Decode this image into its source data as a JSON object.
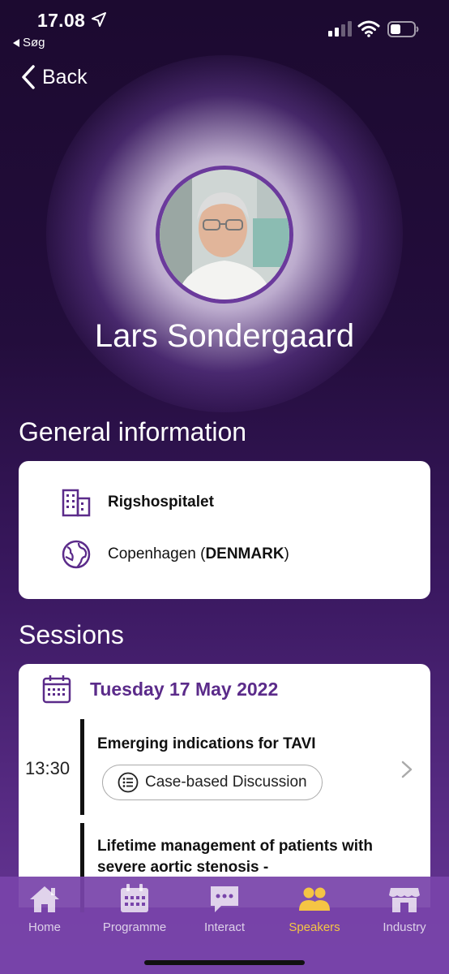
{
  "status_bar": {
    "time": "17.08",
    "back_app": "Søg"
  },
  "nav": {
    "back_label": "Back"
  },
  "speaker": {
    "name": "Lars Sondergaard"
  },
  "general_info": {
    "title": "General information",
    "institution": "Rigshospitalet",
    "city": "Copenhagen (",
    "country": "DENMARK",
    "city_suffix": ")"
  },
  "sessions": {
    "title": "Sessions",
    "date": "Tuesday 17 May 2022",
    "items": [
      {
        "time": "13:30",
        "title": "Emerging indications for TAVI",
        "tag": "Case-based Discussion"
      },
      {
        "time": "",
        "title": "Lifetime management of patients with severe aortic stenosis -",
        "tag": ""
      }
    ]
  },
  "tabs": [
    {
      "label": "Home",
      "icon": "home-icon",
      "active": false
    },
    {
      "label": "Programme",
      "icon": "calendar-icon",
      "active": false
    },
    {
      "label": "Interact",
      "icon": "chat-icon",
      "active": false
    },
    {
      "label": "Speakers",
      "icon": "people-icon",
      "active": true
    },
    {
      "label": "Industry",
      "icon": "store-icon",
      "active": false
    }
  ],
  "colors": {
    "accent": "#5b2b8a",
    "active_tab": "#f5c544",
    "tab_bar": "#7844aa"
  }
}
